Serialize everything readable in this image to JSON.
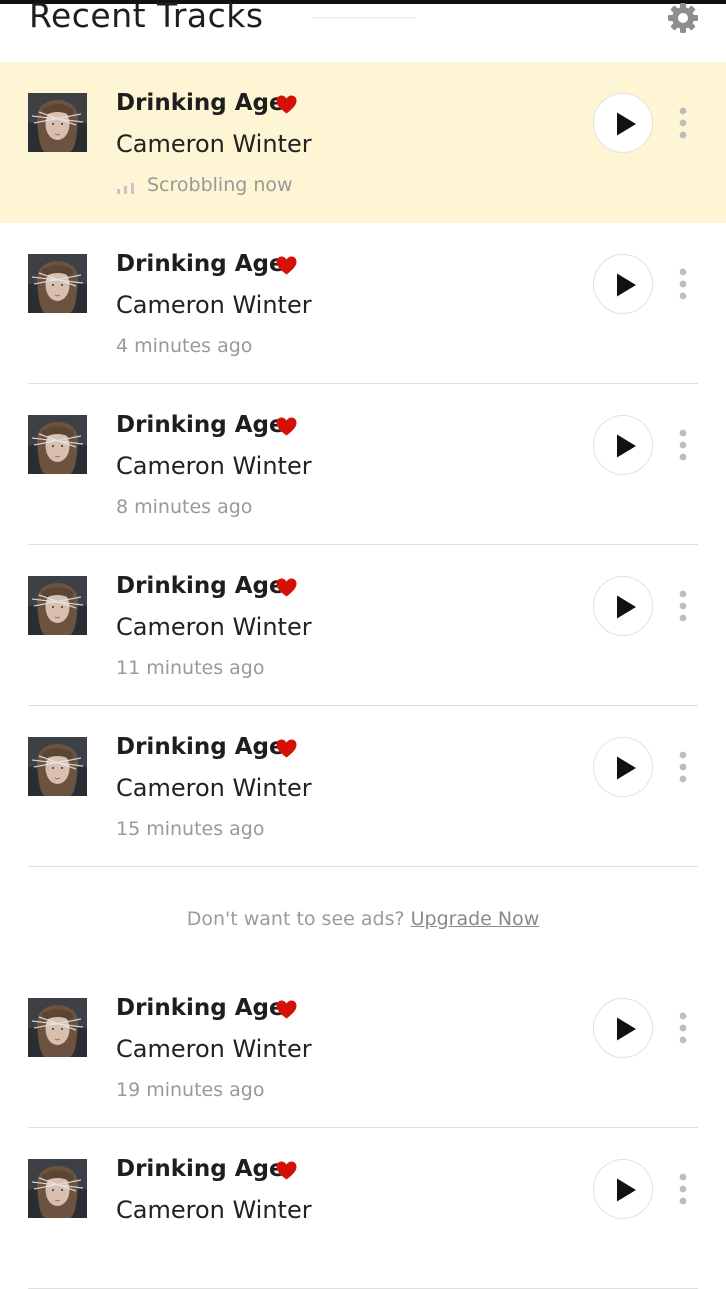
{
  "header": {
    "title": "Recent Tracks",
    "settings_icon": "gear-icon"
  },
  "tracks_top": [
    {
      "title": "Drinking Age",
      "artist": "Cameron Winter",
      "time": "Scrobbling now",
      "now_playing": true,
      "loved": true
    },
    {
      "title": "Drinking Age",
      "artist": "Cameron Winter",
      "time": "4 minutes ago",
      "now_playing": false,
      "loved": true
    },
    {
      "title": "Drinking Age",
      "artist": "Cameron Winter",
      "time": "8 minutes ago",
      "now_playing": false,
      "loved": true
    },
    {
      "title": "Drinking Age",
      "artist": "Cameron Winter",
      "time": "11 minutes ago",
      "now_playing": false,
      "loved": true
    },
    {
      "title": "Drinking Age",
      "artist": "Cameron Winter",
      "time": "15 minutes ago",
      "now_playing": false,
      "loved": true
    }
  ],
  "ad": {
    "text": "Don't want to see ads?",
    "link": "Upgrade Now"
  },
  "tracks_bottom": [
    {
      "title": "Drinking Age",
      "artist": "Cameron Winter",
      "time": "19 minutes ago",
      "now_playing": false,
      "loved": true
    },
    {
      "title": "Drinking Age",
      "artist": "Cameron Winter",
      "time": "",
      "now_playing": false,
      "loved": true
    }
  ],
  "colors": {
    "now_playing_bg": "#fdf5d3",
    "heart": "#d51007",
    "muted_text": "#999999",
    "divider": "#dedede"
  },
  "icons": {
    "love": "heart-icon",
    "play": "play-icon",
    "more": "more-vertical-icon",
    "scrobbling": "scrobble-bars-icon"
  }
}
